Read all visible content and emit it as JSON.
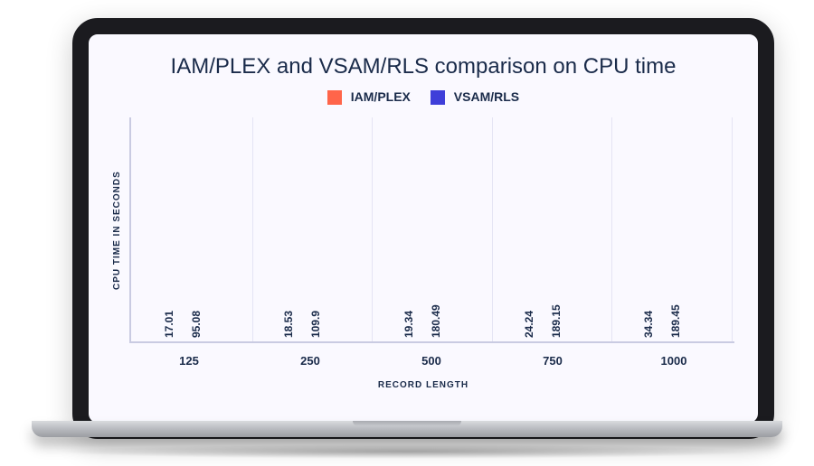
{
  "chart_data": {
    "type": "bar",
    "title": "IAM/PLEX and VSAM/RLS comparison on CPU time",
    "xlabel": "RECORD LENGTH",
    "ylabel": "CPU TIME IN SECONDS",
    "ylim": [
      0,
      200
    ],
    "categories": [
      "125",
      "250",
      "500",
      "750",
      "1000"
    ],
    "series": [
      {
        "name": "IAM/PLEX",
        "color": "#ff654a",
        "values": [
          17.01,
          18.53,
          19.34,
          24.24,
          34.34
        ]
      },
      {
        "name": "VSAM/RLS",
        "color": "#3f3fd9",
        "values": [
          95.08,
          109.9,
          180.49,
          189.15,
          189.45
        ]
      }
    ]
  }
}
